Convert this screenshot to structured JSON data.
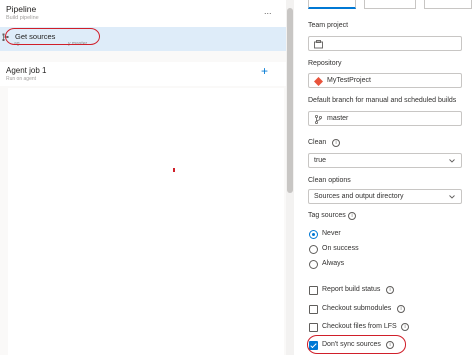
{
  "pipeline": {
    "title": "Pipeline",
    "subtitle": "Build pipeline",
    "more_label": "..."
  },
  "get_sources": {
    "label": "Get sources",
    "sub_left": "ag",
    "sub_right": "y master"
  },
  "agent_job": {
    "title": "Agent job 1",
    "subtitle": "Run on agent",
    "add_label": "+"
  },
  "settings": {
    "team_project": {
      "label": "Team project",
      "value": ""
    },
    "repository": {
      "label": "Repository",
      "value": "MyTestProject"
    },
    "default_branch": {
      "label": "Default branch for manual and scheduled builds",
      "value": "master"
    },
    "clean": {
      "label": "Clean",
      "info": "i",
      "value": "true"
    },
    "clean_options": {
      "label": "Clean options",
      "value": "Sources and output directory"
    },
    "tag_sources": {
      "label": "Tag sources",
      "info": "i",
      "options": [
        "Never",
        "On success",
        "Always"
      ],
      "selected": "Never"
    },
    "checkboxes": [
      {
        "label": "Report build status",
        "info": "i",
        "checked": false
      },
      {
        "label": "Checkout submodules",
        "info": "i",
        "checked": false
      },
      {
        "label": "Checkout files from LFS",
        "info": "i",
        "checked": false
      },
      {
        "label": "Don't sync sources",
        "info": "i",
        "checked": true
      }
    ]
  },
  "colors": {
    "accent": "#0078d4",
    "selected_row": "#deecf9",
    "highlight_ring": "#d01f2a",
    "repo_icon": "#e8533b"
  },
  "icons": [
    "repo-source-icon",
    "more-icon",
    "add-icon",
    "project-icon",
    "git-repo-icon",
    "branch-icon",
    "chevron-down-icon",
    "info-icon",
    "checkmark-icon"
  ]
}
